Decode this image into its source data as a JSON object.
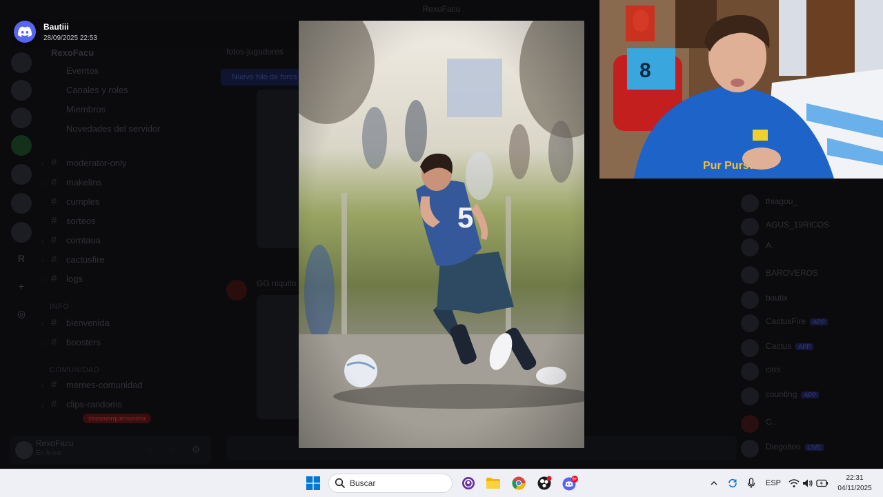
{
  "window": {
    "title": "RexoFacu"
  },
  "notification": {
    "sender": "Bautiii",
    "timestamp": "28/09/2025 22:53",
    "icon": "discord-icon"
  },
  "background_app": {
    "server_name": "RexoFacu",
    "quick_links": [
      "Eventos",
      "Canales y roles",
      "Miembros",
      "Novedades del servidor"
    ],
    "channels": [
      {
        "name": "moderator-only"
      },
      {
        "name": "makelins"
      },
      {
        "name": "cumples"
      },
      {
        "name": "sorteos"
      },
      {
        "name": "comtaua"
      },
      {
        "name": "cactusfire"
      },
      {
        "name": "logs"
      }
    ],
    "category_info": "INFO",
    "info_channels": [
      {
        "name": "bienvenida"
      },
      {
        "name": "boosters"
      }
    ],
    "category_community": "COMUNIDAD",
    "community_channels": [
      {
        "name": "memes-comunidad"
      },
      {
        "name": "clips-randoms"
      }
    ],
    "live_pill": "streamerquemuestra",
    "user": {
      "name": "RexoFacu",
      "status": "En linea"
    },
    "chat_header": "fotos-jugadores",
    "thread_chip": "Nuevo hilo de foros",
    "message_author": "GG niquito",
    "members": [
      {
        "name": "thiagou_"
      },
      {
        "name": "AGUS_19RICOS"
      },
      {
        "name": "A."
      },
      {
        "name": "BAROVEROS"
      },
      {
        "name": "bautix"
      },
      {
        "name": "CactusFire",
        "badge": "APP"
      },
      {
        "name": "Cactus",
        "badge": "APP"
      },
      {
        "name": "clos"
      },
      {
        "name": "counting",
        "badge": "APP"
      },
      {
        "name": "C.."
      },
      {
        "name": "Diegoltoo",
        "badge": "LIVE"
      }
    ]
  },
  "taskbar": {
    "search_placeholder": "Buscar",
    "language": "ESP",
    "time": "22:31",
    "date": "04/11/2025",
    "discord_badge": "9+",
    "colors": {
      "accent": "#0078d4",
      "discord": "#5865f2",
      "badge": "#e81224"
    },
    "apps": [
      "windows-start-icon",
      "search-icon",
      "copilot-icon",
      "file-explorer-icon",
      "chrome-icon",
      "obs-icon",
      "discord-icon"
    ],
    "tray": [
      "chevron-up-icon",
      "sync-icon",
      "microphone-icon",
      "wifi-icon",
      "speaker-icon",
      "battery-icon"
    ]
  }
}
